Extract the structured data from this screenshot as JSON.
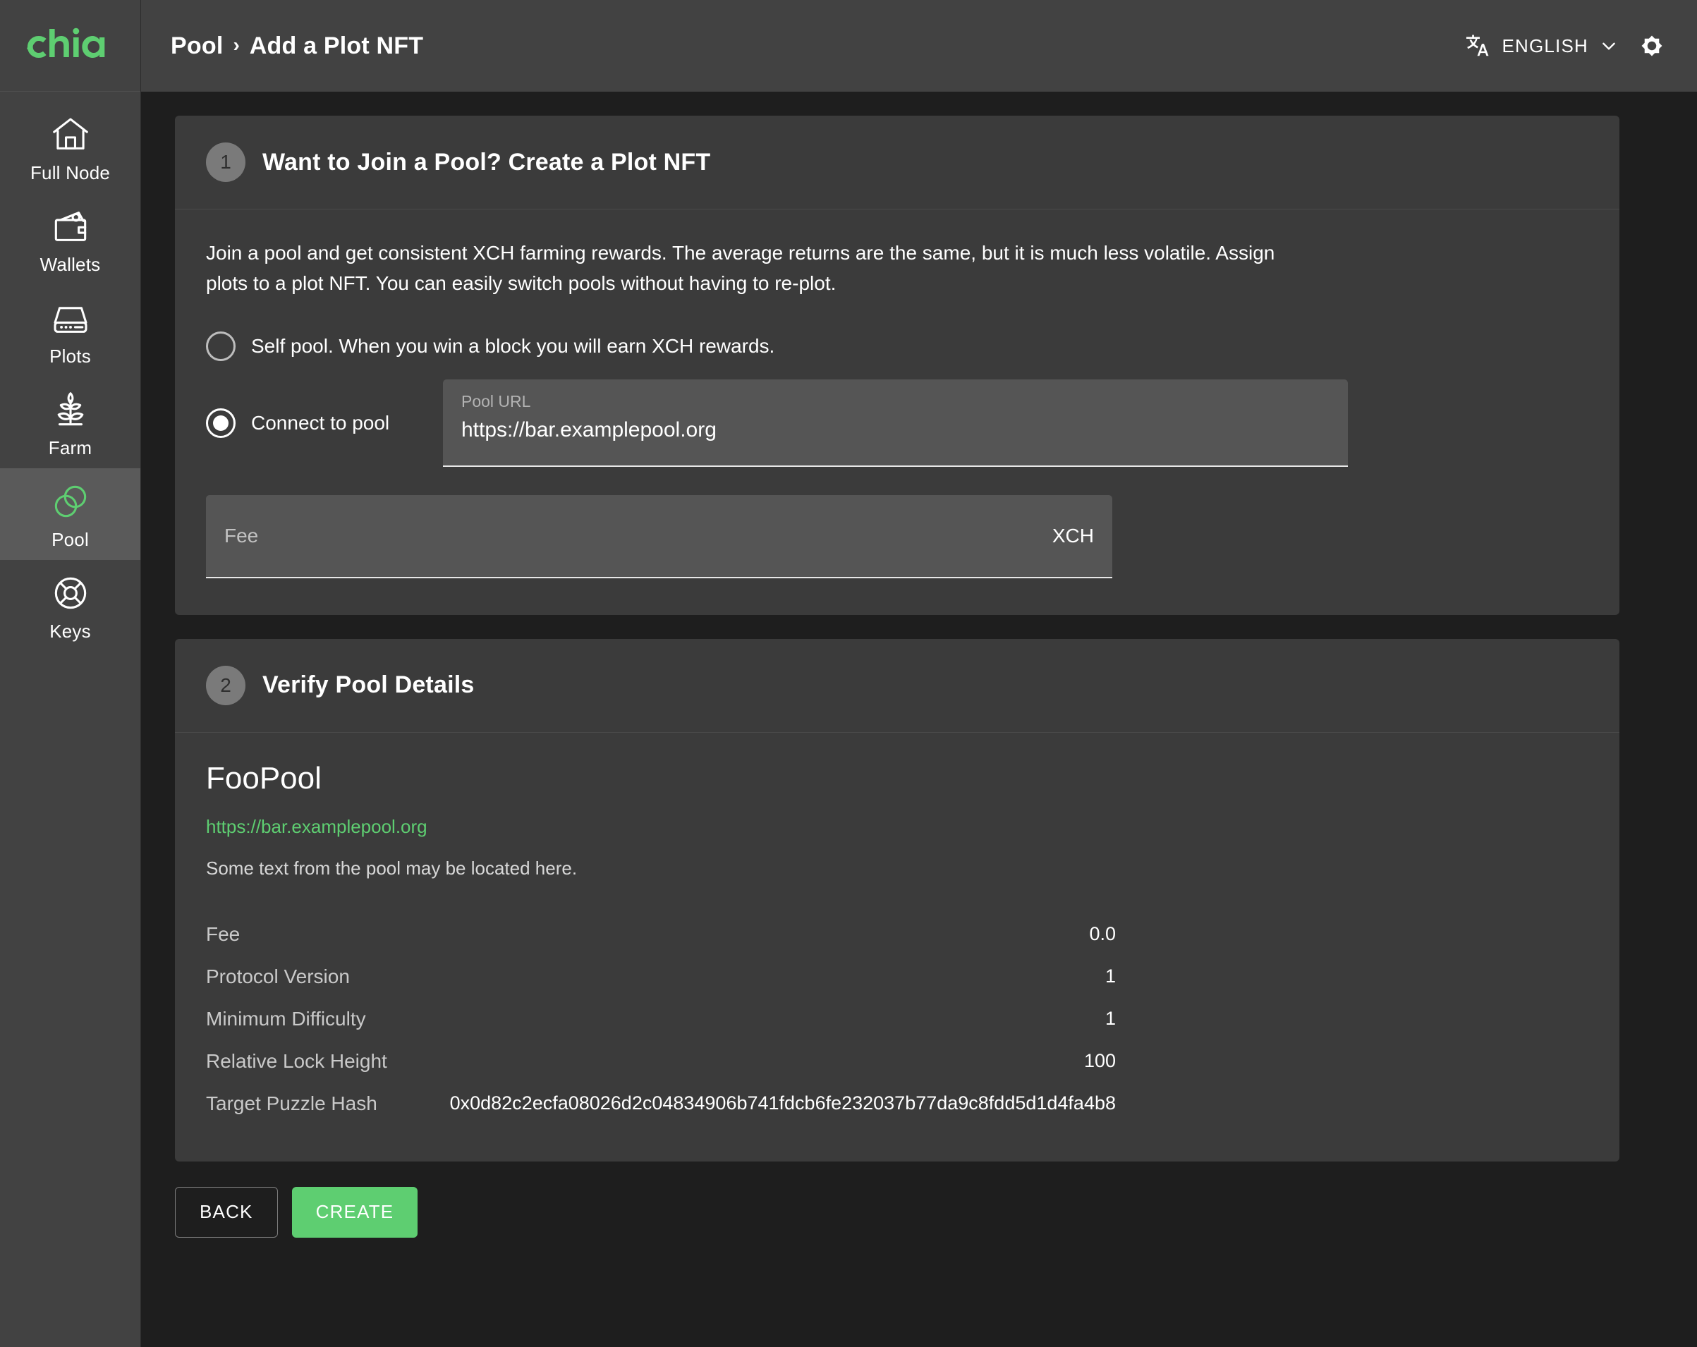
{
  "app": {
    "logo_text": "chia",
    "brand_color": "#5ECE71"
  },
  "sidebar": {
    "items": [
      {
        "label": "Full Node",
        "icon": "home-icon",
        "active": false
      },
      {
        "label": "Wallets",
        "icon": "wallet-icon",
        "active": false
      },
      {
        "label": "Plots",
        "icon": "harddrive-icon",
        "active": false
      },
      {
        "label": "Farm",
        "icon": "sprout-icon",
        "active": false
      },
      {
        "label": "Pool",
        "icon": "pool-circles-icon",
        "active": true
      },
      {
        "label": "Keys",
        "icon": "lifebuoy-icon",
        "active": false
      }
    ]
  },
  "topbar": {
    "breadcrumb": {
      "parent": "Pool",
      "separator": "›",
      "current": "Add a Plot NFT"
    },
    "language": {
      "icon": "translate-icon",
      "label": "ENGLISH",
      "chevron": "chevron-down-icon"
    },
    "settings_icon": "gear-icon"
  },
  "step1": {
    "number": "1",
    "title": "Want to Join a Pool? Create a Plot NFT",
    "paragraph": "Join a pool and get consistent XCH farming rewards. The average returns are the same, but it is much less volatile. Assign plots to a plot NFT. You can easily switch pools without having to re-plot.",
    "option_self": {
      "label": "Self pool. When you win a block you will earn XCH rewards.",
      "selected": false
    },
    "option_pool": {
      "label": "Connect to pool",
      "selected": true
    },
    "pool_url_field": {
      "label": "Pool URL",
      "value": "https://bar.examplepool.org"
    },
    "fee_field": {
      "placeholder": "Fee",
      "value": "",
      "suffix": "XCH"
    }
  },
  "step2": {
    "number": "2",
    "title": "Verify Pool Details",
    "pool_name": "FooPool",
    "pool_url": "https://bar.examplepool.org",
    "pool_description": "Some text from the pool may be located here.",
    "details": [
      {
        "key": "Fee",
        "value": "0.0"
      },
      {
        "key": "Protocol Version",
        "value": "1"
      },
      {
        "key": "Minimum Difficulty",
        "value": "1"
      },
      {
        "key": "Relative Lock Height",
        "value": "100"
      },
      {
        "key": "Target Puzzle Hash",
        "value": "0x0d82c2ecfa08026d2c04834906b741fdcb6fe232037b77da9c8fdd5d1d4fa4b8"
      }
    ]
  },
  "actions": {
    "back_label": "BACK",
    "create_label": "CREATE"
  }
}
